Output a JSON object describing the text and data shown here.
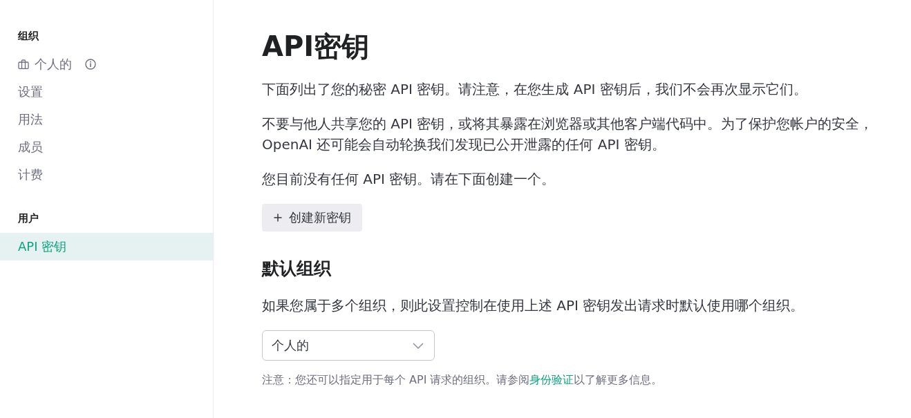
{
  "sidebar": {
    "sections": [
      {
        "heading": "组织",
        "items": [
          {
            "kind": "org",
            "label": "个人的",
            "selected": false
          },
          {
            "kind": "link",
            "label": "设置",
            "selected": false
          },
          {
            "kind": "link",
            "label": "用法",
            "selected": false
          },
          {
            "kind": "link",
            "label": "成员",
            "selected": false
          },
          {
            "kind": "link",
            "label": "计费",
            "selected": false
          }
        ]
      },
      {
        "heading": "用户",
        "items": [
          {
            "kind": "link",
            "label": "API 密钥",
            "selected": true
          }
        ]
      }
    ]
  },
  "main": {
    "title": "API密钥",
    "paragraphs": [
      "下面列出了您的秘密 API 密钥。请注意，在您生成 API 密钥后，我们不会再次显示它们。",
      "不要与他人共享您的 API 密钥，或将其暴露在浏览器或其他客户端代码中。为了保护您帐户的安全，OpenAI 还可能会自动轮换我们发现已公开泄露的任何 API 密钥。",
      "您目前没有任何 API 密钥。请在下面创建一个。"
    ],
    "create_button": {
      "label": "创建新密钥"
    },
    "default_org": {
      "heading": "默认组织",
      "description": "如果您属于多个组织，则此设置控制在使用上述 API 密钥发出请求时默认使用哪个组织。",
      "select": {
        "value": "个人的"
      },
      "note": {
        "text_before": "注意：您还可以指定用于每个 API 请求的组织。请参阅",
        "link": "身份验证",
        "text_after": "以了解更多信息。"
      }
    }
  }
}
